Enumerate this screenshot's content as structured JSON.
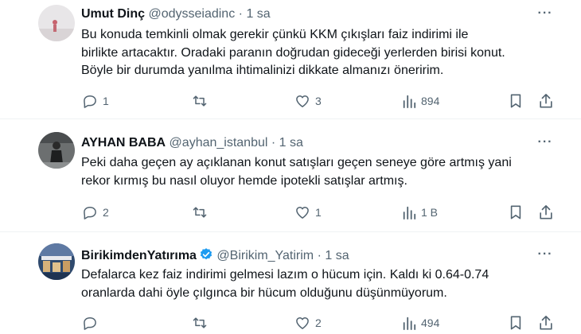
{
  "tweets": [
    {
      "name": "Umut Dinç",
      "handle": "@odysseiadinc",
      "dot": "·",
      "time": "1 sa",
      "more": "···",
      "verified": false,
      "lines": [
        "Bu konuda temkinli olmak gerekir çünkü KKM çıkışları faiz indirimi ile",
        "birlikte artacaktır. Oradaki paranın doğrudan gideceği yerlerden birisi konut.",
        "Böyle bir durumda yanılma ihtimalinizi dikkate almanızı öneririm."
      ],
      "replies": "1",
      "retweets": "",
      "likes": "3",
      "views": "894"
    },
    {
      "name": "AYHAN BABA",
      "handle": "@ayhan_istanbul",
      "dot": "·",
      "time": "1 sa",
      "more": "···",
      "verified": false,
      "lines": [
        "Peki daha geçen ay açıklanan konut satışları geçen seneye göre artmış yani",
        "rekor kırmış bu nasıl oluyor hemde ipotekli satışlar artmış."
      ],
      "replies": "2",
      "retweets": "",
      "likes": "1",
      "views": "1 B"
    },
    {
      "name": "BirikimdenYatırıma",
      "handle": "@Birikim_Yatirim",
      "dot": "·",
      "time": "1 sa",
      "more": "···",
      "verified": true,
      "lines": [
        "Defalarca kez faiz indirimi gelmesi lazım o hücum için. Kaldı ki 0.64-0.74",
        "oranlarda dahi öyle çılgınca bir hücum olduğunu düşünmüyorum."
      ],
      "replies": "",
      "retweets": "",
      "likes": "2",
      "views": "494"
    }
  ],
  "colors": {
    "text": "#0f1419",
    "secondary": "#536471",
    "verified": "#1d9bf0",
    "divider": "#eff3f4"
  },
  "icons": [
    "reply-icon",
    "retweet-icon",
    "like-icon",
    "views-icon",
    "bookmark-icon",
    "share-icon",
    "more-icon",
    "verified-icon"
  ]
}
